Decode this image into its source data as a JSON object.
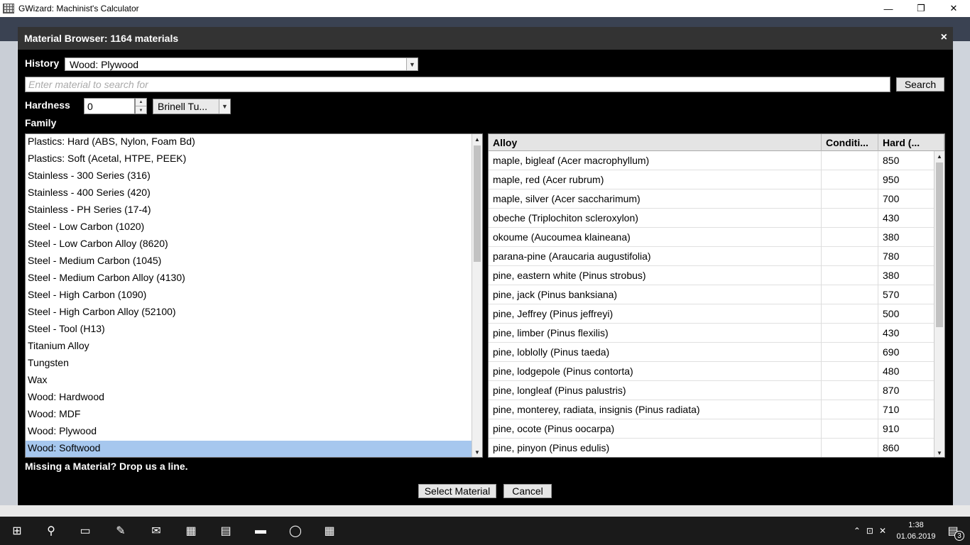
{
  "window": {
    "title": "GWizard: Machinist's Calculator",
    "minimize_glyph": "—",
    "maximize_glyph": "❐",
    "close_glyph": "✕"
  },
  "modal": {
    "title": "Material Browser: 1164 materials",
    "close_glyph": "×",
    "history_label": "History",
    "history_value": "Wood: Plywood",
    "search_placeholder": "Enter material to search for",
    "search_button": "Search",
    "hardness_label": "Hardness",
    "hardness_value": "0",
    "hardness_unit": "Brinell Tu...",
    "family_label": "Family",
    "missing_text": "Missing a Material? Drop us a line.",
    "select_button": "Select Material",
    "cancel_button": "Cancel"
  },
  "family_items": [
    "Plastics: Hard (ABS, Nylon, Foam Bd)",
    "Plastics: Soft (Acetal, HTPE, PEEK)",
    "Stainless - 300 Series (316)",
    "Stainless - 400 Series (420)",
    "Stainless - PH Series (17-4)",
    "Steel - Low Carbon (1020)",
    "Steel - Low Carbon Alloy (8620)",
    "Steel - Medium Carbon (1045)",
    "Steel - Medium Carbon Alloy (4130)",
    "Steel - High Carbon (1090)",
    "Steel - High Carbon Alloy (52100)",
    "Steel - Tool (H13)",
    "Titanium Alloy",
    "Tungsten",
    "Wax",
    "Wood: Hardwood",
    "Wood: MDF",
    "Wood: Plywood",
    "Wood: Softwood"
  ],
  "family_selected_index": 18,
  "alloy_table": {
    "headers": [
      "Alloy",
      "Conditi...",
      "Hard (..."
    ],
    "rows": [
      {
        "alloy": "maple, bigleaf (Acer macrophyllum)",
        "condition": "",
        "hardness": "850"
      },
      {
        "alloy": "maple, red (Acer rubrum)",
        "condition": "",
        "hardness": "950"
      },
      {
        "alloy": "maple, silver (Acer saccharimum)",
        "condition": "",
        "hardness": "700"
      },
      {
        "alloy": "obeche (Triplochiton scleroxylon)",
        "condition": "",
        "hardness": "430"
      },
      {
        "alloy": "okoume (Aucoumea klaineana)",
        "condition": "",
        "hardness": "380"
      },
      {
        "alloy": "parana-pine (Araucaria augustifolia)",
        "condition": "",
        "hardness": "780"
      },
      {
        "alloy": "pine, eastern white (Pinus strobus)",
        "condition": "",
        "hardness": "380"
      },
      {
        "alloy": "pine, jack (Pinus banksiana)",
        "condition": "",
        "hardness": "570"
      },
      {
        "alloy": "pine, Jeffrey (Pinus jeffreyi)",
        "condition": "",
        "hardness": "500"
      },
      {
        "alloy": "pine, limber (Pinus flexilis)",
        "condition": "",
        "hardness": "430"
      },
      {
        "alloy": "pine, loblolly (Pinus taeda)",
        "condition": "",
        "hardness": "690"
      },
      {
        "alloy": "pine, lodgepole (Pinus contorta)",
        "condition": "",
        "hardness": "480"
      },
      {
        "alloy": "pine, longleaf (Pinus palustris)",
        "condition": "",
        "hardness": "870"
      },
      {
        "alloy": "pine, monterey, radiata, insignis (Pinus radiata)",
        "condition": "",
        "hardness": "710"
      },
      {
        "alloy": "pine, ocote (Pinus oocarpa)",
        "condition": "",
        "hardness": "910"
      },
      {
        "alloy": "pine, pinyon (Pinus edulis)",
        "condition": "",
        "hardness": "860"
      }
    ]
  },
  "taskbar": {
    "clock_time": "1:38",
    "clock_date": "01.06.2019",
    "notification_count": "3"
  },
  "colors": {
    "modal_bg": "#000000",
    "modal_header": "#333333",
    "selection": "#a6c7ee",
    "taskbar": "#1a1a1a"
  }
}
